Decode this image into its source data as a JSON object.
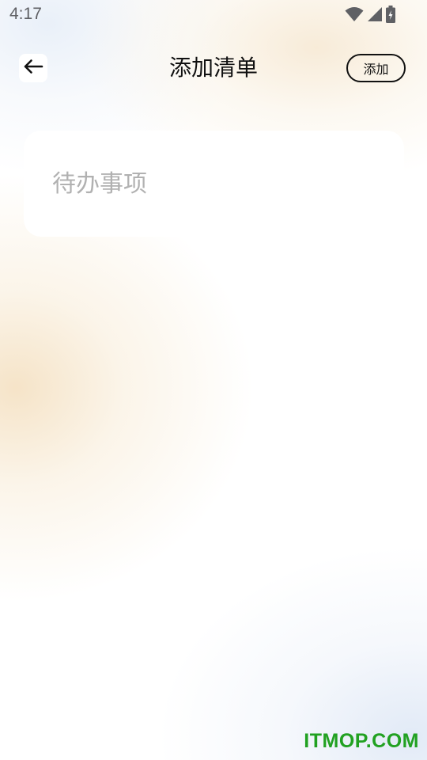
{
  "status_bar": {
    "time": "4:17",
    "icons": [
      "wifi-icon",
      "signal-icon",
      "battery-charging-icon"
    ]
  },
  "header": {
    "title": "添加清单",
    "back_icon": "arrow-left-icon",
    "add_label": "添加"
  },
  "form": {
    "todo_value": "",
    "todo_placeholder": "待办事项"
  },
  "watermark": {
    "text": "ITMOP.COM",
    "color": "#21a121"
  },
  "colors": {
    "text_primary": "#111111",
    "placeholder": "#b1b1b1",
    "card": "#ffffff"
  }
}
